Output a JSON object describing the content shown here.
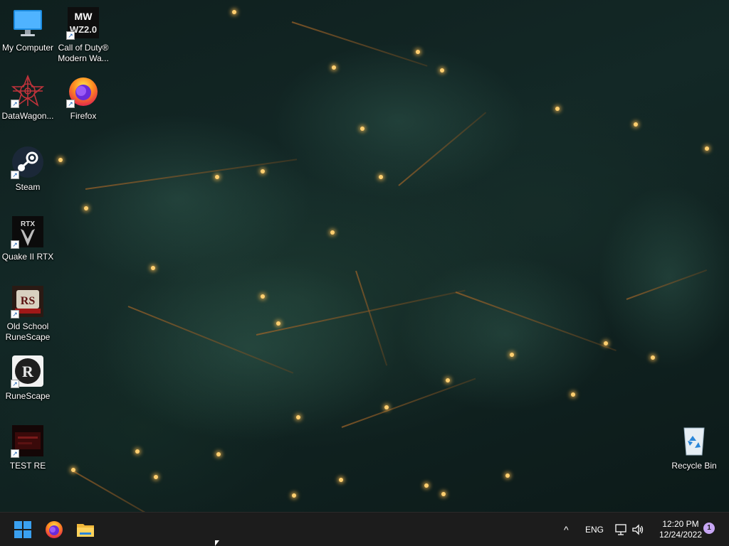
{
  "desktop": {
    "wallpaper": "christmas-tree-lights",
    "icons": [
      {
        "label": "My Computer",
        "icon": "computer-icon"
      },
      {
        "label": "Call of Duty®\nModern Wa...",
        "icon": "cod-mwii-icon",
        "badge_text": "MW\nWZ2.0"
      },
      {
        "label": "DataWagon...",
        "icon": "datawagon-icon"
      },
      {
        "label": "Firefox",
        "icon": "firefox-icon"
      },
      {
        "label": "Steam",
        "icon": "steam-icon"
      },
      {
        "label": "Quake II RTX",
        "icon": "quake-rtx-icon",
        "badge_text": "RTX"
      },
      {
        "label": "Old School\nRuneScape",
        "icon": "osrs-icon",
        "badge_text": "RS"
      },
      {
        "label": "RuneScape",
        "icon": "runescape-icon",
        "badge_text": "R"
      },
      {
        "label": "TEST RE",
        "icon": "test-re-icon"
      },
      {
        "label": "Recycle Bin",
        "icon": "recycle-bin-icon"
      }
    ]
  },
  "taskbar": {
    "pinned": [
      {
        "name": "Start",
        "icon": "windows-start-icon"
      },
      {
        "name": "Firefox",
        "icon": "firefox-icon"
      },
      {
        "name": "File Explorer",
        "icon": "folder-icon"
      }
    ],
    "tray": {
      "chevron": "^",
      "language": "ENG",
      "time": "12:20 PM",
      "date": "12/24/2022",
      "notification_count": "1"
    }
  },
  "colors": {
    "taskbar_bg": "#1c1c1c",
    "accent_blue": "#1c8ce0",
    "notification_badge": "#c7a6f4"
  }
}
